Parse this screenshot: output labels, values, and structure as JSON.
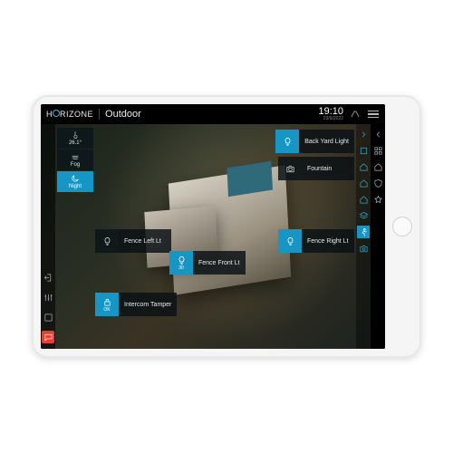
{
  "brand": {
    "pre": "H",
    "post": "RIZONE"
  },
  "header": {
    "title": "Outdoor",
    "time": "19:10",
    "date": "23/6/2022"
  },
  "info": {
    "temp": "26.1°",
    "weather": "Fog",
    "scene": "Night"
  },
  "tiles": {
    "backyard": {
      "label": "Back Yard Light"
    },
    "fountain": {
      "label": "Fountain"
    },
    "fenceL": {
      "label": "Fence Left Lt"
    },
    "fenceF": {
      "label": "Fence Front Lt",
      "sub": "30"
    },
    "fenceR": {
      "label": "Fence Right Lt"
    },
    "intercom": {
      "label": "Intercom Tamper",
      "sub": "OK"
    }
  },
  "colors": {
    "accent": "#1596c4",
    "alert": "#e4402f"
  }
}
